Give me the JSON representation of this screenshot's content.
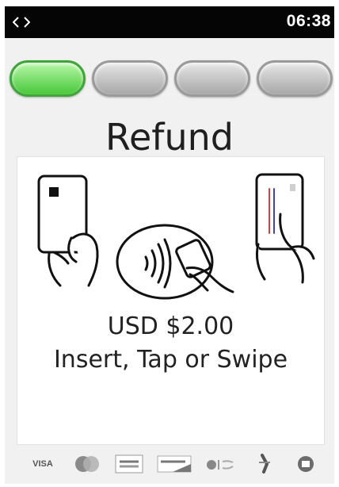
{
  "status_bar": {
    "time": "06:38",
    "icon": "code-arrows-icon"
  },
  "progress": {
    "total_steps": 4,
    "current_step": 1,
    "active_color": "#4ac63c",
    "inactive_color": "#b5b5b5"
  },
  "screen": {
    "title": "Refund",
    "amount": "USD $2.00",
    "instruction": "Insert, Tap or Swipe"
  },
  "illustration": {
    "icons": [
      "card-insert-icon",
      "contactless-tap-icon",
      "card-swipe-icon"
    ]
  },
  "payment_logos": {
    "visa_label": "VISA",
    "icons": [
      "visa-logo-icon",
      "mastercard-logo-icon",
      "amex-logo-icon",
      "discover-logo-icon",
      "apple-pay-logo-icon",
      "google-pay-logo-icon",
      "samsung-pay-logo-icon"
    ]
  }
}
